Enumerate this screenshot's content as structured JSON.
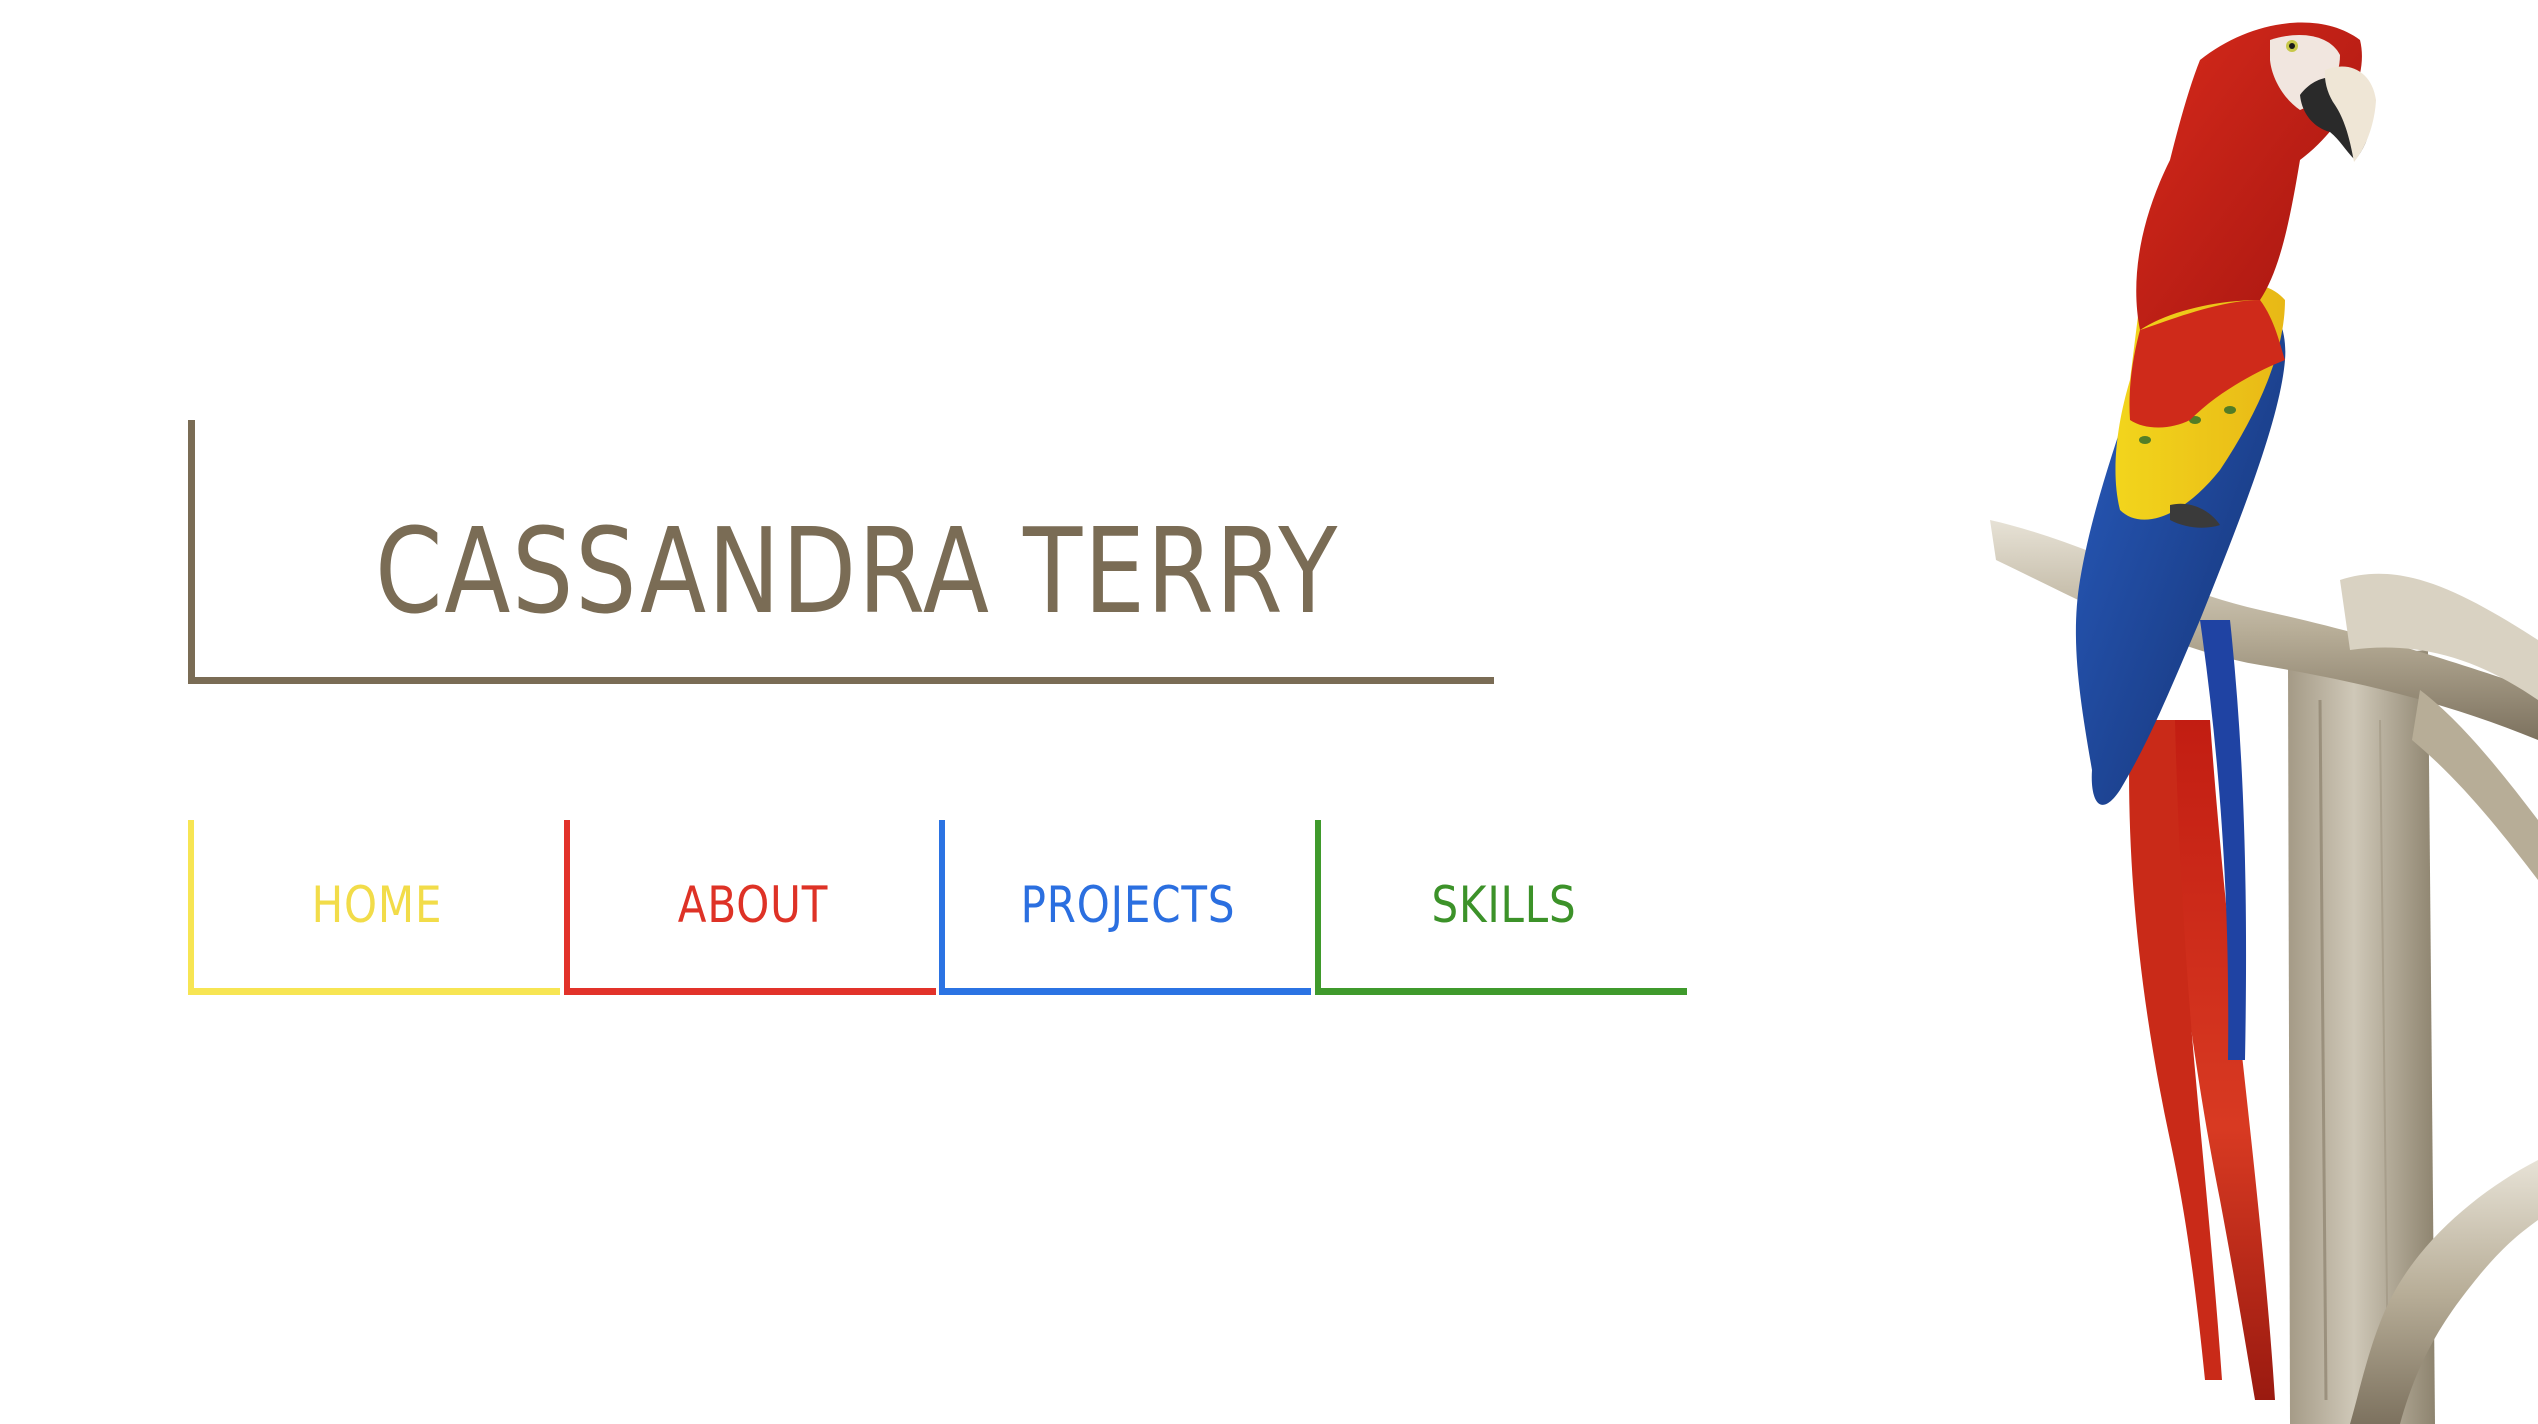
{
  "header": {
    "name": "CASSANDRA TERRY"
  },
  "nav": {
    "items": [
      {
        "label": "HOME",
        "color": "#f7e553"
      },
      {
        "label": "ABOUT",
        "color": "#e2322a"
      },
      {
        "label": "PROJECTS",
        "color": "#2b73e3"
      },
      {
        "label": "SKILLS",
        "color": "#3f9a2c"
      }
    ]
  },
  "theme": {
    "title_color": "#7a6c55",
    "background": "#ffffff"
  },
  "hero_image": {
    "subject": "scarlet-macaw-on-branch"
  }
}
